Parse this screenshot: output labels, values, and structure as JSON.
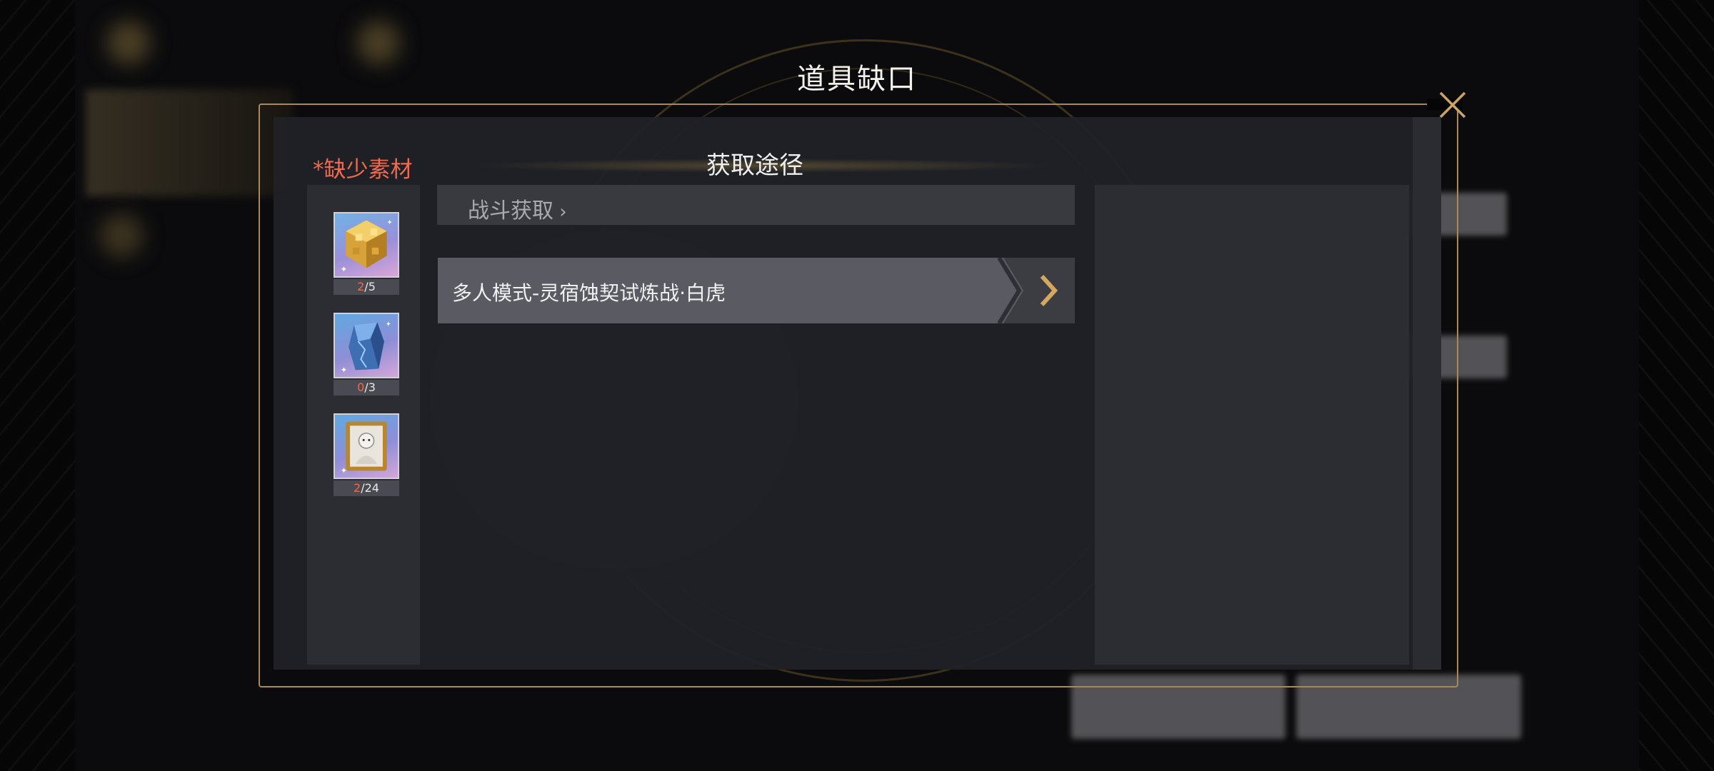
{
  "dialog": {
    "title": "道具缺口",
    "missing_label": "*缺少素材",
    "route_title": "获取途径",
    "battle_label": "战斗获取"
  },
  "items": [
    {
      "icon": "gold-cube-material-icon",
      "have": "2",
      "need": "/5"
    },
    {
      "icon": "blue-crystal-material-icon",
      "have": "0",
      "need": "/3"
    },
    {
      "icon": "portrait-frame-material-icon",
      "have": "2",
      "need": "/24"
    }
  ],
  "routes": [
    {
      "label": "多人模式-灵宿蚀契试炼战·白虎"
    }
  ],
  "colors": {
    "accent_gold": "#a88a55",
    "warning_red": "#f06a4f"
  }
}
